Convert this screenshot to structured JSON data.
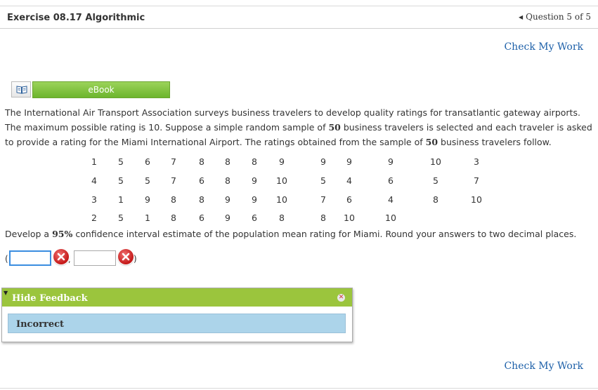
{
  "header": {
    "title": "Exercise 08.17 Algorithmic",
    "question_nav": "Question 5 of 5"
  },
  "check_work_label": "Check My Work",
  "ebook": {
    "label": "eBook",
    "icon": "book-icon"
  },
  "question": {
    "p1": "The International Air Transport Association surveys business travelers to develop quality ratings for transatlantic gateway airports. The maximum possible rating is 10. Suppose a simple random sample of ",
    "n1": "50",
    "p2": " business travelers is selected and each traveler is asked to provide a rating for the Miami International Airport. The ratings obtained from the sample of ",
    "n2": "50",
    "p3": " business travelers follow."
  },
  "ratings": [
    [
      "1",
      "5",
      "6",
      "7",
      "8",
      "8",
      "8",
      "9",
      "9",
      "9",
      "9",
      "10",
      "3"
    ],
    [
      "4",
      "5",
      "5",
      "7",
      "6",
      "8",
      "9",
      "10",
      "5",
      "4",
      "6",
      "5",
      "7"
    ],
    [
      "3",
      "1",
      "9",
      "8",
      "8",
      "9",
      "9",
      "10",
      "7",
      "6",
      "4",
      "8",
      "10"
    ],
    [
      "2",
      "5",
      "1",
      "8",
      "6",
      "9",
      "6",
      "8",
      "8",
      "10",
      "10",
      "",
      ""
    ]
  ],
  "instruction": {
    "pre": "Develop a ",
    "pct": "95%",
    "post": " confidence interval estimate of the population mean rating for Miami. Round your answers to two decimal places."
  },
  "answer": {
    "open_paren": "(",
    "comma": ",",
    "close_paren": ")",
    "value1": "",
    "value2": ""
  },
  "feedback": {
    "title": "Hide Feedback",
    "result": "Incorrect"
  },
  "colors": {
    "link": "#1c5fa8",
    "ebook_green": "#7cc03a",
    "feedback_green": "#9bc53d",
    "feedback_box": "#acd4ea",
    "error_red": "#c41818"
  }
}
